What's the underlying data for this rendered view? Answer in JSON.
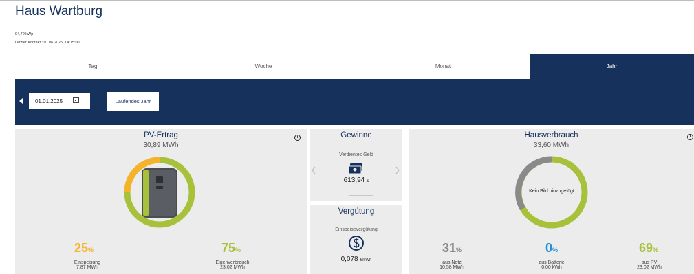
{
  "header": {
    "title": "Haus Wartburg",
    "capacity": "94,79 kWp",
    "last_contact": "Letzter Kontakt : 01.06.2025, 14:15:00"
  },
  "tabs": [
    {
      "label": "Tag",
      "active": false
    },
    {
      "label": "Woche",
      "active": false
    },
    {
      "label": "Monat",
      "active": false
    },
    {
      "label": "Jahr",
      "active": true
    }
  ],
  "controls": {
    "date_value": "01.01.2025",
    "current_year_button": "Laufendes Jahr"
  },
  "pv_ertrag": {
    "title": "PV-Ertrag",
    "total": "30,89 MWh",
    "feed_in_percent": "25",
    "feed_in_label": "Einspeisung",
    "feed_in_value": "7,87 MWh",
    "self_use_percent": "75",
    "self_use_label": "Eigenverbrauch",
    "self_use_value": "23,02 MWh",
    "pct_unit": "%"
  },
  "gewinne": {
    "title": "Gewinne",
    "label": "Verdientes Geld",
    "value": "613,94",
    "unit": "€"
  },
  "verguetung": {
    "title": "Vergütung",
    "label": "Einspeisevergütung",
    "value": "0,078",
    "unit": "€/kWh"
  },
  "hausverbrauch": {
    "title": "Hausverbrauch",
    "total": "33,60 MWh",
    "placeholder": "Kein Bild hinzugefügt",
    "grid_percent": "31",
    "grid_label": "aus Netz",
    "grid_value": "10,58 MWh",
    "battery_percent": "0",
    "battery_label": "aus Batterie",
    "battery_value": "0,00 kWh",
    "pv_percent": "69",
    "pv_label": "aus PV",
    "pv_value": "23,02 MWh",
    "pct_unit": "%"
  },
  "colors": {
    "navy": "#16325c",
    "green": "#a7c13a",
    "orange": "#f5b22b",
    "blue": "#1f8fd6",
    "gray": "#8a8a8a",
    "card_bg": "#ececec"
  }
}
